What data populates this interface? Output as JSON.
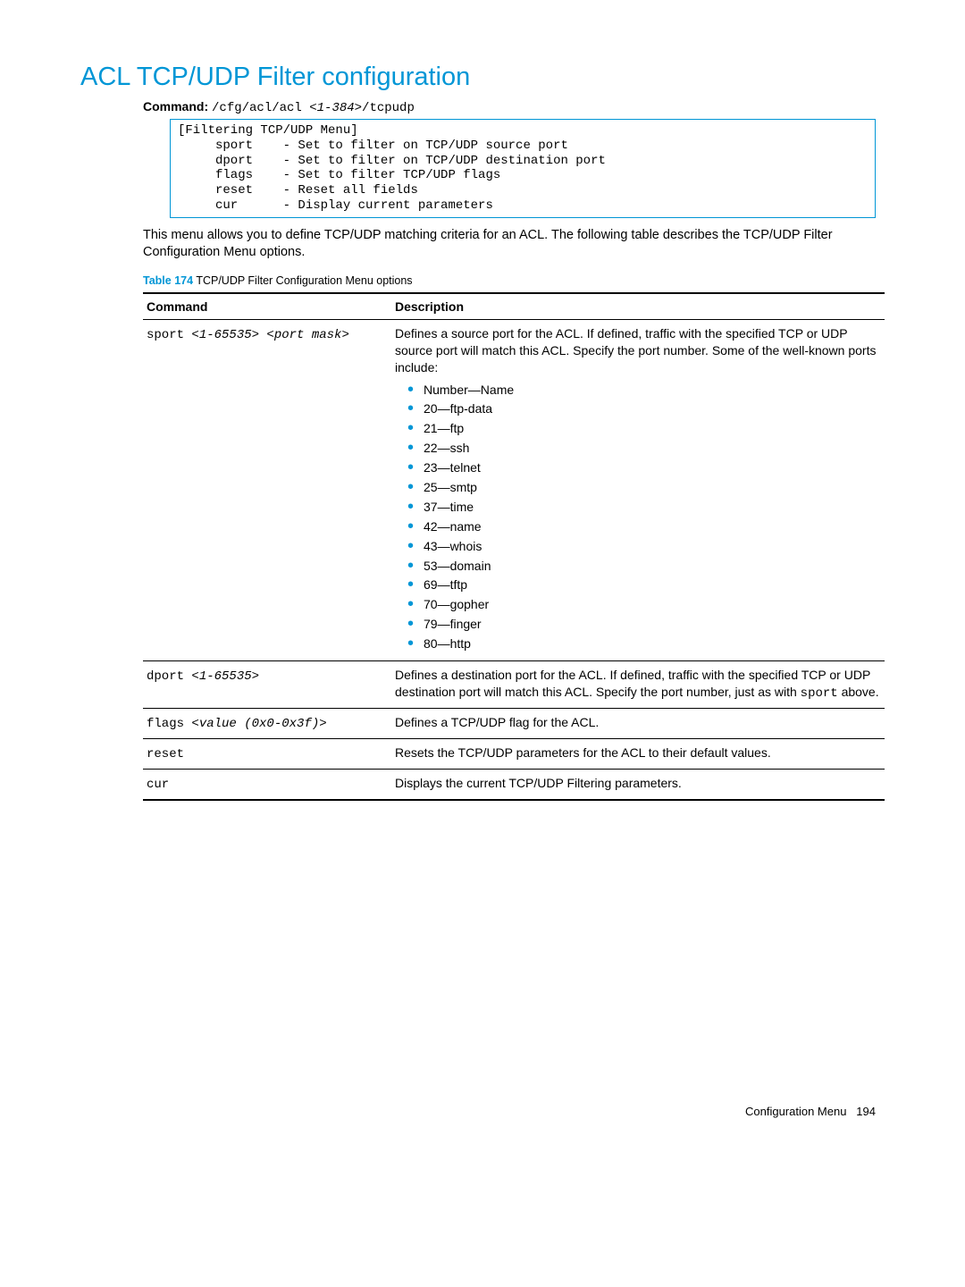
{
  "title": "ACL TCP/UDP Filter configuration",
  "command_label": "Command:",
  "command_path": "/cfg/acl/acl ",
  "command_arg": "<1-384>",
  "command_suffix": "/tcpudp",
  "menu_box": "[Filtering TCP/UDP Menu]\n     sport    - Set to filter on TCP/UDP source port\n     dport    - Set to filter on TCP/UDP destination port\n     flags    - Set to filter TCP/UDP flags\n     reset    - Reset all fields\n     cur      - Display current parameters",
  "intro": "This menu allows you to define TCP/UDP matching criteria for an ACL. The following table describes the TCP/UDP Filter Configuration Menu options.",
  "table_caption_num": "Table 174",
  "table_caption_text": "TCP/UDP Filter Configuration Menu options",
  "headers": {
    "command": "Command",
    "description": "Description"
  },
  "rows": [
    {
      "cmd_prefix": "sport ",
      "cmd_arg": "<1-65535> <port mask>",
      "desc_pre": "Defines a source port for the ACL. If defined, traffic with the specified TCP or UDP source port will match this ACL. Specify the port number. Some of the well-known ports include:",
      "ports": [
        "Number—Name",
        "20—ftp-data",
        "21—ftp",
        "22—ssh",
        "23—telnet",
        "25—smtp",
        "37—time",
        "42—name",
        "43—whois",
        "53—domain",
        "69—tftp",
        "70—gopher",
        "79—finger",
        "80—http"
      ]
    },
    {
      "cmd_prefix": "dport ",
      "cmd_arg": "<1-65535>",
      "desc_parts": [
        "Defines a destination port for the ACL. If defined, traffic with the specified TCP or UDP destination port will match this ACL. Specify the port number, just as with ",
        "sport",
        " above."
      ]
    },
    {
      "cmd_prefix": "flags ",
      "cmd_arg": "<value (0x0-0x3f)>",
      "desc": "Defines a TCP/UDP flag for the ACL."
    },
    {
      "cmd_prefix": "reset",
      "cmd_arg": "",
      "desc": "Resets the TCP/UDP parameters for the ACL to their default values."
    },
    {
      "cmd_prefix": "cur",
      "cmd_arg": "",
      "desc": "Displays the current TCP/UDP Filtering parameters."
    }
  ],
  "footer_label": "Configuration Menu",
  "footer_page": "194"
}
